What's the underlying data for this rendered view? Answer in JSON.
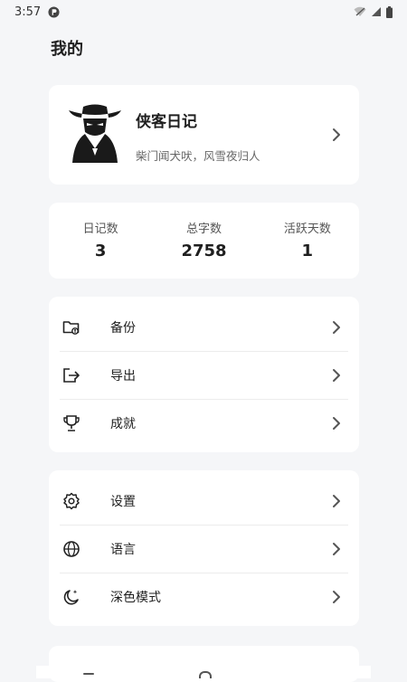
{
  "status": {
    "time": "3:57"
  },
  "header": {
    "title": "我的"
  },
  "profile": {
    "name": "侠客日记",
    "motto": "柴门闻犬吠，风雪夜归人"
  },
  "stats": [
    {
      "label": "日记数",
      "value": "3"
    },
    {
      "label": "总字数",
      "value": "2758"
    },
    {
      "label": "活跃天数",
      "value": "1"
    }
  ],
  "menu_group_1": [
    {
      "label": "备份",
      "icon": "backup-folder-icon"
    },
    {
      "label": "导出",
      "icon": "export-icon"
    },
    {
      "label": "成就",
      "icon": "trophy-icon"
    }
  ],
  "menu_group_2": [
    {
      "label": "设置",
      "icon": "gear-icon"
    },
    {
      "label": "语言",
      "icon": "globe-icon"
    },
    {
      "label": "深色模式",
      "icon": "moon-icon"
    }
  ]
}
